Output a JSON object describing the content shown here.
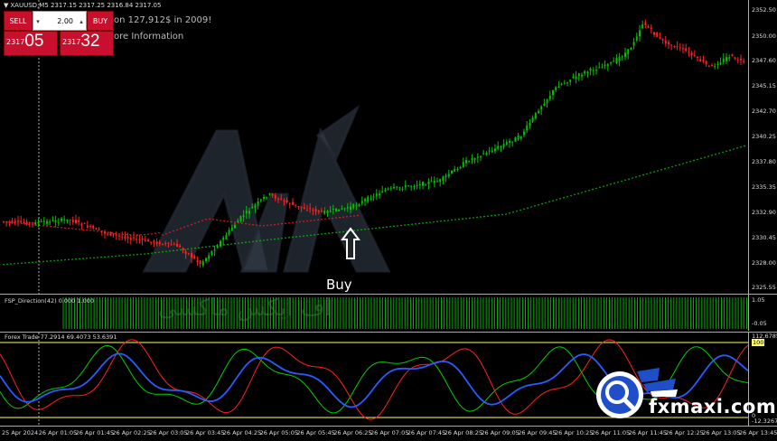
{
  "symbol": {
    "text": "XAUUSD,M5  2317.15 2317.25 2316.84 2317.05"
  },
  "trade_panel": {
    "sell_label": "SELL",
    "buy_label": "BUY",
    "lot_value": "2.00",
    "sell_price_small": "2317",
    "sell_price_big": "05",
    "buy_price_small": "2317",
    "buy_price_big": "32"
  },
  "news": {
    "line1": "on 127,912$ in 2009!",
    "line2": "ore Information"
  },
  "main_axis": {
    "ticks": [
      "2352.50",
      "2350.00",
      "2347.60",
      "2345.15",
      "2342.70",
      "2340.25",
      "2337.80",
      "2335.35",
      "2332.90",
      "2330.45",
      "2328.00",
      "2325.55"
    ]
  },
  "fsp": {
    "label": "FSP_Direction(42) 0.000 1.000",
    "ticks": [
      "1.05",
      "-0.05"
    ]
  },
  "forex_trade": {
    "label": "Forex Trade 77.2914 69.4073 53.6391",
    "ticks": [
      "112.6785",
      "100",
      "0",
      "-12.3267"
    ]
  },
  "x_axis": {
    "ticks": [
      "25 Apr 2024",
      "26 Apr 01:05",
      "26 Apr 01:45",
      "26 Apr 02:25",
      "26 Apr 03:05",
      "26 Apr 03:45",
      "26 Apr 04:25",
      "26 Apr 05:05",
      "26 Apr 05:45",
      "26 Apr 06:25",
      "26 Apr 07:05",
      "26 Apr 07:45",
      "26 Apr 08:25",
      "26 Apr 09:05",
      "26 Apr 09:45",
      "26 Apr 10:25",
      "26 Apr 11:05",
      "26 Apr 11:45",
      "26 Apr 12:25",
      "26 Apr 13:05",
      "26 Apr 13:45"
    ]
  },
  "annotation": {
    "buy_label": "Buy",
    "buy_arrow_icon": "up-arrow-icon"
  },
  "watermark": {
    "brand": "fxmaxi.com",
    "persian": "اف ایکس ماکسی",
    "logo_icon": "magnifier-icon"
  },
  "colors": {
    "sell": "#c8102e",
    "buy": "#c8102e",
    "bull_candle": "#00c000",
    "bear_candle": "#ff2020",
    "ma_green": "#00d000",
    "ma_red": "#ff2020",
    "line_blue": "#1e5bff",
    "axis": "#aaaaaa"
  }
}
